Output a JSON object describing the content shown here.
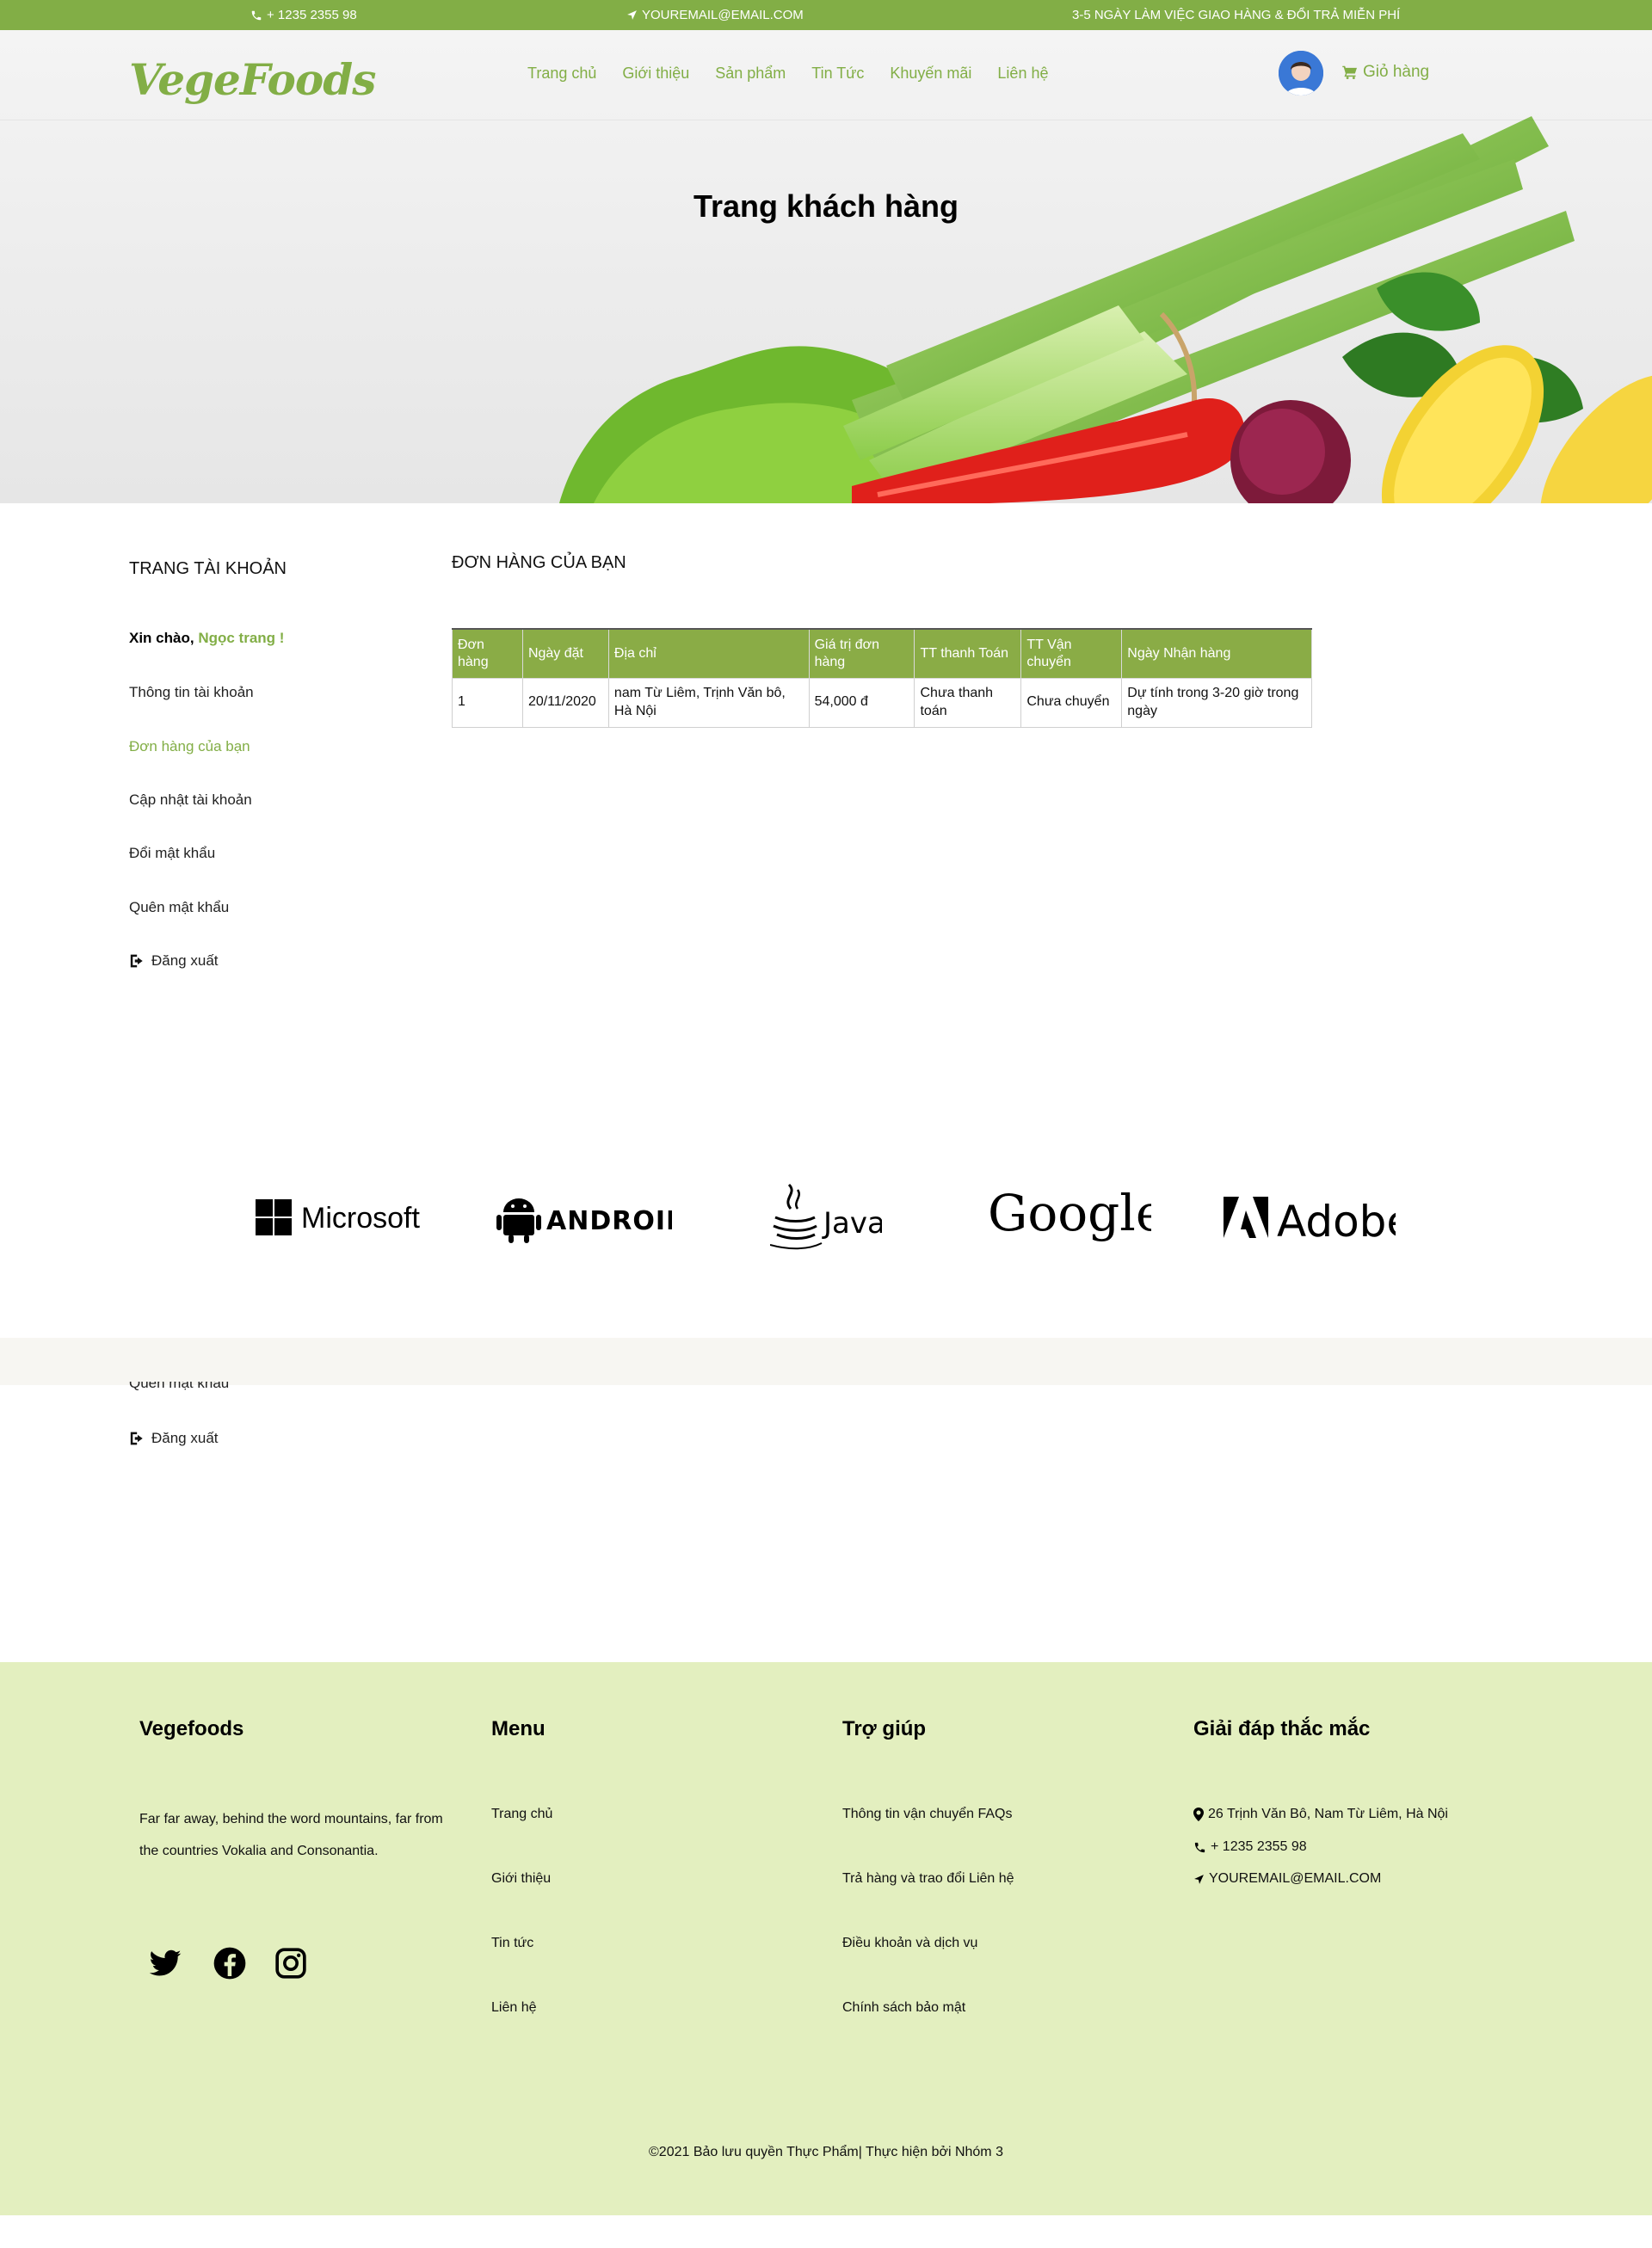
{
  "topbar": {
    "phone": "+ 1235 2355 98",
    "email": "YOUREMAIL@EMAIL.COM",
    "promo": "3-5 NGÀY LÀM VIỆC GIAO HÀNG & ĐỔI TRẢ MIỄN PHÍ"
  },
  "header": {
    "logo": "VegeFoods",
    "nav": [
      "Trang chủ",
      "Giới thiệu",
      "Sản phẩm",
      "Tin Tức",
      "Khuyến mãi",
      "Liên hệ"
    ],
    "cart_label": "Giỏ hàng"
  },
  "hero": {
    "title": "Trang khách hàng"
  },
  "sidebar": {
    "title": "TRANG TÀI KHOẢN",
    "greeting": "Xin chào,",
    "user_name": "Ngọc trang !",
    "items": [
      "Thông tin tài khoản",
      "Đơn hàng của bạn",
      "Cập nhật tài khoản",
      "Đổi mật khẩu",
      "Quên mật khẩu",
      "Đăng xuất"
    ],
    "ghost_clipped": "Quên mật khẩu",
    "ghost_logout": "Đăng xuất"
  },
  "orders": {
    "title": "ĐƠN HÀNG CỦA BẠN",
    "headers": [
      "Đơn hàng",
      "Ngày đặt",
      "Địa chỉ",
      "Giá trị đơn hàng",
      "TT thanh Toán",
      "TT Vận chuyển",
      "Ngày Nhận hàng"
    ],
    "rows": [
      [
        "1",
        "20/11/2020",
        "nam Từ Liêm, Trịnh Văn bô, Hà Nội",
        "54,000 đ",
        "Chưa thanh toán",
        "Chưa chuyển",
        "Dự tính trong 3-20 giờ trong ngày"
      ]
    ]
  },
  "partners": [
    "Microsoft",
    "ANDROID",
    "Java",
    "Google",
    "Adobe"
  ],
  "footer": {
    "brand": "Vegefoods",
    "description": "Far far away, behind the word mountains, far from the countries Vokalia and Consonantia.",
    "menu_title": "Menu",
    "menu": [
      "Trang chủ",
      "Giới thiệu",
      "Tin tức",
      "Liên hệ"
    ],
    "help_title": "Trợ giúp",
    "help": [
      "Thông tin vận chuyển FAQs",
      "Trả hàng và trao đổi Liên hệ",
      "Điều khoản và dịch vụ",
      "Chính sách bảo mật"
    ],
    "faq_title": "Giải đáp thắc mắc",
    "address": "26 Trịnh Văn Bô, Nam Từ Liêm, Hà Nội",
    "phone": "+ 1235 2355 98",
    "email": "YOUREMAIL@EMAIL.COM",
    "social": [
      "twitter-icon",
      "facebook-icon",
      "instagram-icon"
    ],
    "copyright": "©2021 Bảo lưu quyền Thực Phẩm| Thực hiện bởi Nhóm 3"
  },
  "colors": {
    "accent": "#82ae46",
    "footer_bg": "#e3efbf"
  }
}
